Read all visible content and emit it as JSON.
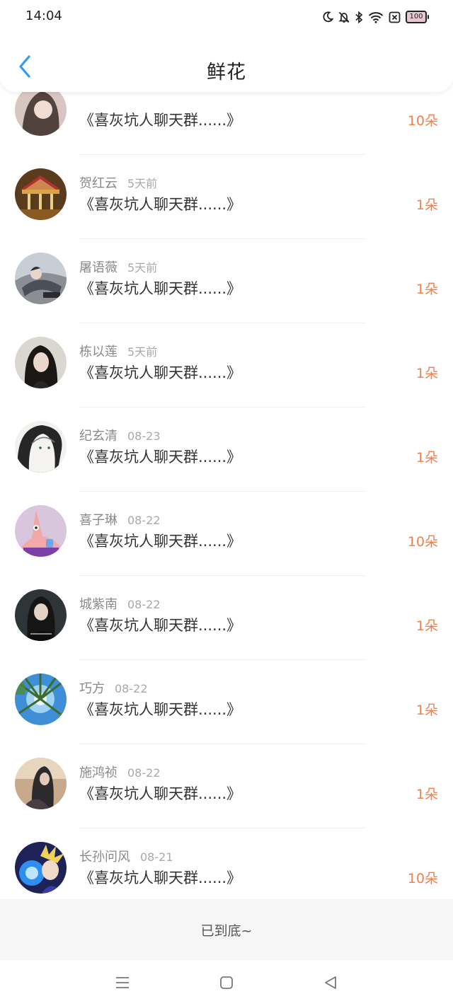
{
  "status_bar": {
    "time": "14:04",
    "icons": [
      "moon-icon",
      "mute-bell-icon",
      "bluetooth-icon",
      "wifi-icon",
      "sim-x-icon"
    ],
    "battery": "100"
  },
  "header": {
    "back_icon": "chevron-left-icon",
    "title": "鲜花",
    "accent_color": "#2f9cf2"
  },
  "colors": {
    "count": "#f0814d",
    "name": "#8a8a8a"
  },
  "items": [
    {
      "name": "",
      "time": "",
      "group": "《喜灰坑人聊天群......》",
      "count": "10朵"
    },
    {
      "name": "贺红云",
      "time": "5天前",
      "group": "《喜灰坑人聊天群......》",
      "count": "1朵"
    },
    {
      "name": "屠语薇",
      "time": "5天前",
      "group": "《喜灰坑人聊天群......》",
      "count": "1朵"
    },
    {
      "name": "栋以莲",
      "time": "5天前",
      "group": "《喜灰坑人聊天群......》",
      "count": "1朵"
    },
    {
      "name": "纪玄清",
      "time": "08-23",
      "group": "《喜灰坑人聊天群......》",
      "count": "1朵"
    },
    {
      "name": "喜子琳",
      "time": "08-22",
      "group": "《喜灰坑人聊天群......》",
      "count": "10朵"
    },
    {
      "name": "城紫南",
      "time": "08-22",
      "group": "《喜灰坑人聊天群......》",
      "count": "1朵"
    },
    {
      "name": "巧方",
      "time": "08-22",
      "group": "《喜灰坑人聊天群......》",
      "count": "1朵"
    },
    {
      "name": "施鸿祯",
      "time": "08-22",
      "group": "《喜灰坑人聊天群......》",
      "count": "1朵"
    },
    {
      "name": "长孙问风",
      "time": "08-21",
      "group": "《喜灰坑人聊天群......》",
      "count": "10朵"
    }
  ],
  "footer": {
    "end_text": "已到底~"
  },
  "nav": [
    "menu-icon",
    "home-square-icon",
    "back-triangle-icon"
  ]
}
